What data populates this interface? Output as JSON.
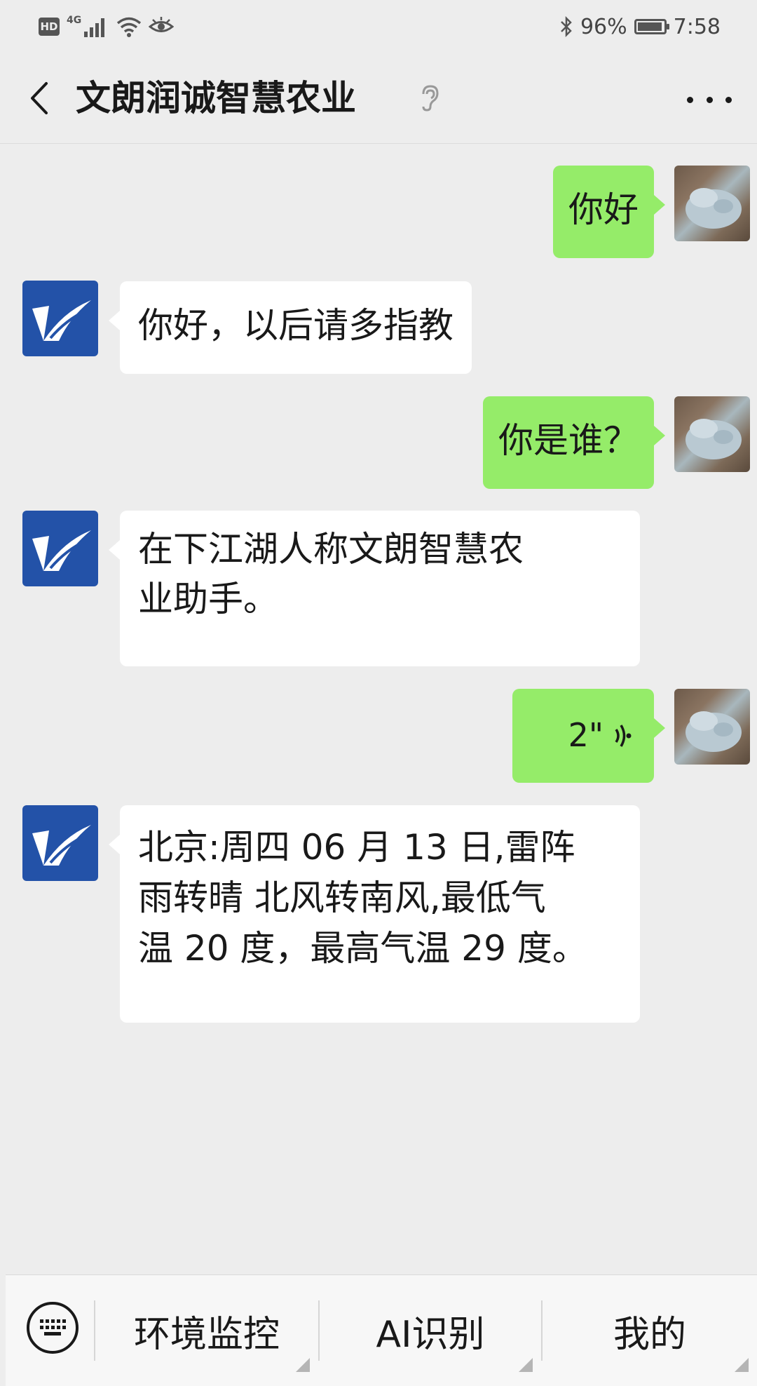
{
  "status_bar": {
    "hd": "HD",
    "network": "4G",
    "battery": "96%",
    "battery_level": 0.96,
    "time": "7:58"
  },
  "header": {
    "title": "文朗润诚智慧农业",
    "back_icon": "chevron-left-icon",
    "ear_icon": "ear-icon",
    "more_icon": "more-icon"
  },
  "messages": [
    {
      "side": "right",
      "type": "text",
      "text": "你好"
    },
    {
      "side": "left",
      "type": "text",
      "text": "你好，以后请多指教"
    },
    {
      "side": "right",
      "type": "text",
      "text": "你是谁？"
    },
    {
      "side": "left",
      "type": "text",
      "line1": "在下江湖人称文朗智慧农",
      "line2": "业助手。"
    },
    {
      "side": "right",
      "type": "voice",
      "duration": "2\""
    },
    {
      "side": "left",
      "type": "text",
      "line1": "北京:周四 06 月 13 日,雷阵",
      "line2": "雨转晴 北风转南风,最低气",
      "line3": "温 20 度，最高气温 29 度。"
    }
  ],
  "bottom_menu": {
    "keyboard_icon": "keyboard-icon",
    "items": [
      {
        "label": "环境监控"
      },
      {
        "label": "AI识别"
      },
      {
        "label": "我的"
      }
    ]
  },
  "colors": {
    "background": "#ededed",
    "outgoing_bubble": "#95ec69",
    "incoming_bubble": "#ffffff",
    "bot_avatar": "#2352a8"
  }
}
